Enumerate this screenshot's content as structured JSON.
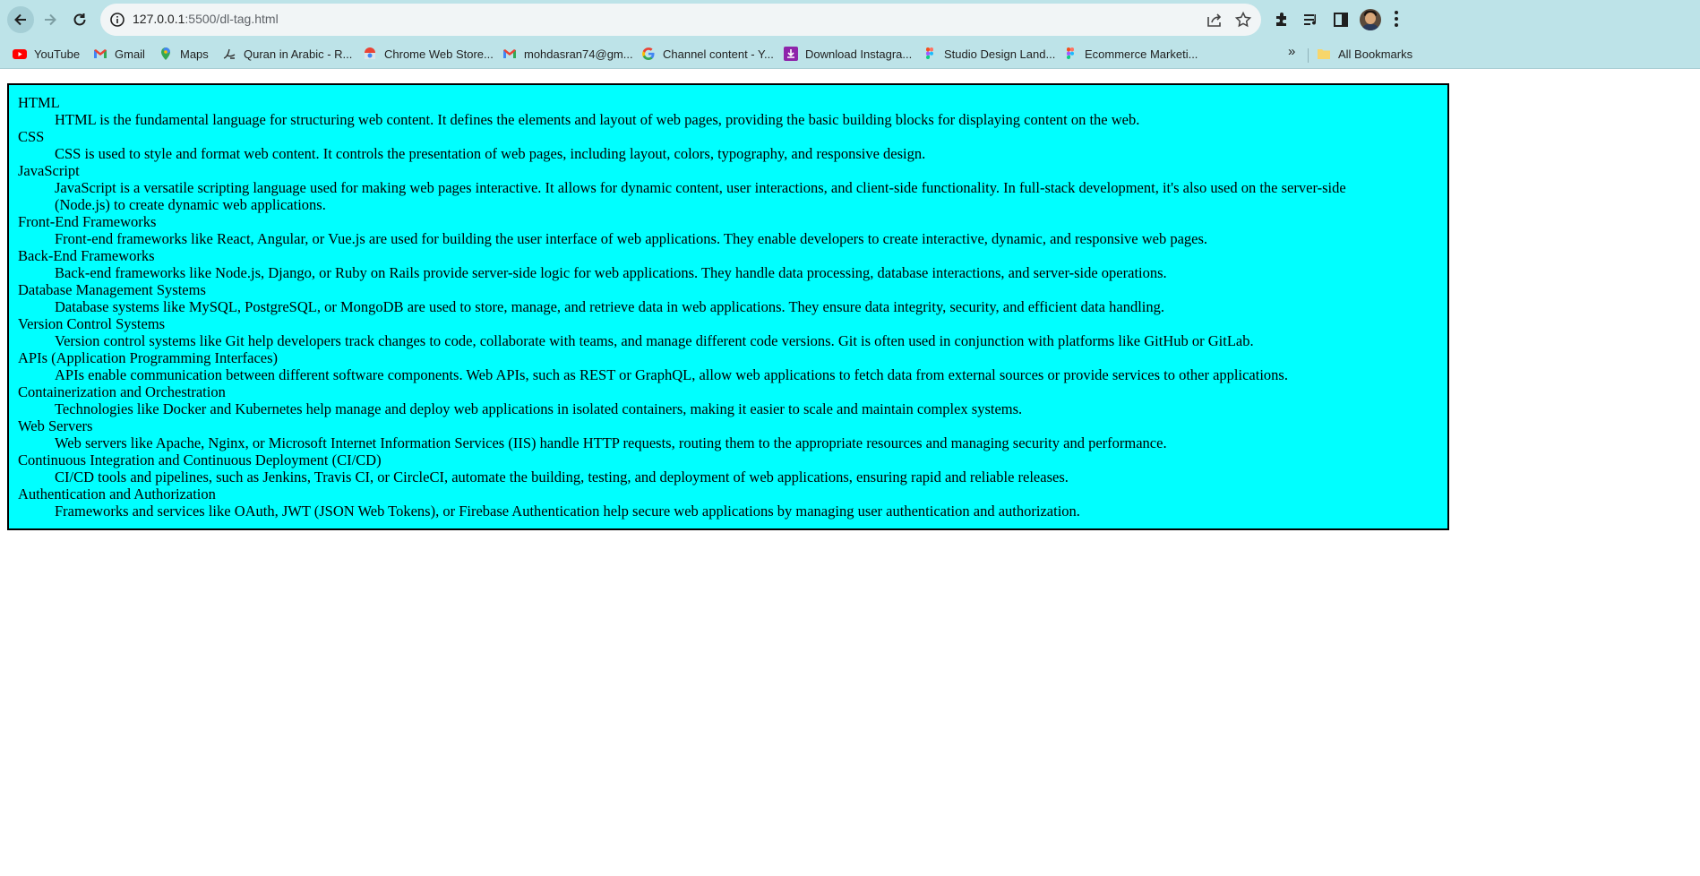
{
  "browser": {
    "url_host": "127.0.0.1",
    "url_path": ":5500/dl-tag.html",
    "bookmarks": [
      {
        "label": "YouTube",
        "icon": "youtube-icon"
      },
      {
        "label": "Gmail",
        "icon": "gmail-icon"
      },
      {
        "label": "Maps",
        "icon": "maps-icon"
      },
      {
        "label": "Quran in Arabic - R...",
        "icon": "quran-icon"
      },
      {
        "label": "Chrome Web Store...",
        "icon": "chrome-web-store-icon"
      },
      {
        "label": "mohdasran74@gm...",
        "icon": "gmail-icon"
      },
      {
        "label": "Channel content - Y...",
        "icon": "google-icon"
      },
      {
        "label": "Download Instagra...",
        "icon": "download-icon"
      },
      {
        "label": "Studio Design Land...",
        "icon": "figma-icon"
      },
      {
        "label": "Ecommerce Marketi...",
        "icon": "figma-icon"
      }
    ],
    "more_bookmarks": "»",
    "all_bookmarks": "All Bookmarks"
  },
  "terms": [
    {
      "term": "HTML",
      "definition": "HTML is the fundamental language for structuring web content. It defines the elements and layout of web pages, providing the basic building blocks for displaying content on the web."
    },
    {
      "term": "CSS",
      "definition": "CSS is used to style and format web content. It controls the presentation of web pages, including layout, colors, typography, and responsive design."
    },
    {
      "term": "JavaScript",
      "definition": "JavaScript is a versatile scripting language used for making web pages interactive. It allows for dynamic content, user interactions, and client-side functionality. In full-stack development, it's also used on the server-side (Node.js) to create dynamic web applications."
    },
    {
      "term": "Front-End Frameworks",
      "definition": "Front-end frameworks like React, Angular, or Vue.js are used for building the user interface of web applications. They enable developers to create interactive, dynamic, and responsive web pages."
    },
    {
      "term": "Back-End Frameworks",
      "definition": "Back-end frameworks like Node.js, Django, or Ruby on Rails provide server-side logic for web applications. They handle data processing, database interactions, and server-side operations."
    },
    {
      "term": "Database Management Systems",
      "definition": "Database systems like MySQL, PostgreSQL, or MongoDB are used to store, manage, and retrieve data in web applications. They ensure data integrity, security, and efficient data handling."
    },
    {
      "term": "Version Control Systems",
      "definition": "Version control systems like Git help developers track changes to code, collaborate with teams, and manage different code versions. Git is often used in conjunction with platforms like GitHub or GitLab."
    },
    {
      "term": "APIs (Application Programming Interfaces)",
      "definition": "APIs enable communication between different software components. Web APIs, such as REST or GraphQL, allow web applications to fetch data from external sources or provide services to other applications."
    },
    {
      "term": "Containerization and Orchestration",
      "definition": "Technologies like Docker and Kubernetes help manage and deploy web applications in isolated containers, making it easier to scale and maintain complex systems."
    },
    {
      "term": "Web Servers",
      "definition": "Web servers like Apache, Nginx, or Microsoft Internet Information Services (IIS) handle HTTP requests, routing them to the appropriate resources and managing security and performance."
    },
    {
      "term": "Continuous Integration and Continuous Deployment (CI/CD)",
      "definition": "CI/CD tools and pipelines, such as Jenkins, Travis CI, or CircleCI, automate the building, testing, and deployment of web applications, ensuring rapid and reliable releases."
    },
    {
      "term": "Authentication and Authorization",
      "definition": "Frameworks and services like OAuth, JWT (JSON Web Tokens), or Firebase Authentication help secure web applications by managing user authentication and authorization."
    }
  ],
  "colors": {
    "toolbar_bg": "#bde3e8",
    "list_bg": "#00ffff",
    "list_border": "#000000"
  }
}
